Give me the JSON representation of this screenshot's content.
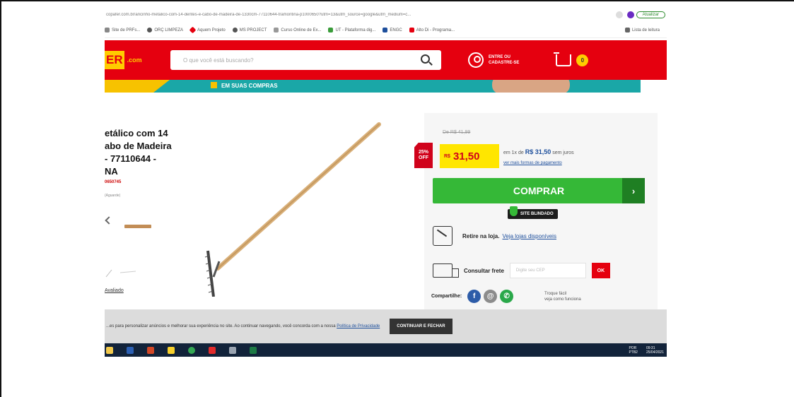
{
  "browser": {
    "url": "copafer.com.br/ancinho-metalico-com-14-dentes-e-cabo-de-madeira-de-1330cm-77110644-tramontina-p1000650?utm=13&utm_source=google&utm_medium=c...",
    "update_label": "Atualizar",
    "bookmarks": [
      {
        "label": "Site de PRFs..."
      },
      {
        "label": "ORÇ LIMPEZA"
      },
      {
        "label": "Aquem Projeto"
      },
      {
        "label": "MS PROJECT"
      },
      {
        "label": "Curso Online de Ex..."
      },
      {
        "label": "UT - Plataforma dig..."
      },
      {
        "label": "ENGC"
      },
      {
        "label": "Alto Di - Programa..."
      }
    ],
    "reading_list": "Lista de leitura"
  },
  "header": {
    "logo_text": "ER",
    "logo_suffix": ".com",
    "search_placeholder": "O que você está buscando?",
    "account_line1": "ENTRE OU",
    "account_line2": "CADASTRE-SE",
    "cart_count": "0"
  },
  "banner": {
    "text": "EM SUAS COMPRAS"
  },
  "product": {
    "title_line1": "etálico com 14",
    "title_line2": "abo de Madeira",
    "title_line3": "- 77110644 -",
    "title_line4": "NA",
    "code": "0650745",
    "rating": "(Aguarde)",
    "related_link": "Avaliado"
  },
  "buy_panel": {
    "old_price": "De R$ 41,99",
    "discount_pct": "25%",
    "discount_word": "OFF",
    "price_currency": "R$",
    "price_value": "31,50",
    "installments_prefix": "em 1x de",
    "installments_value": "R$ 31,50",
    "installments_suffix": "sem juros",
    "payment_link": "ver mais formas de pagamento",
    "buy_label": "COMPRAR",
    "buy_arrow": "›",
    "shield_label": "SITE BLINDADO",
    "pickup_strong": "Retire na loja.",
    "pickup_link": "Veja lojas disponíveis",
    "freight_label": "Consultar frete",
    "cep_placeholder": "Digite seu CEP",
    "ok_label": "OK",
    "share_label": "Compartilhe:",
    "swap_note_line1": "Troque fácil",
    "swap_note_line2": "veja como funciona"
  },
  "cookie": {
    "text": "...es para personalizar anúncios e melhorar sua experiência no site. Ao continuar navegando, você concorda com a nossa",
    "link": "Política de Privacidade",
    "button": "CONTINUAR E FECHAR"
  },
  "taskbar": {
    "lang": "POR",
    "lang2": "PTB2",
    "time": "09:31",
    "date": "25/04/2021"
  },
  "colors": {
    "brand_red": "#e5000f",
    "brand_yellow": "#ffcc00",
    "buy_green": "#35b837"
  }
}
